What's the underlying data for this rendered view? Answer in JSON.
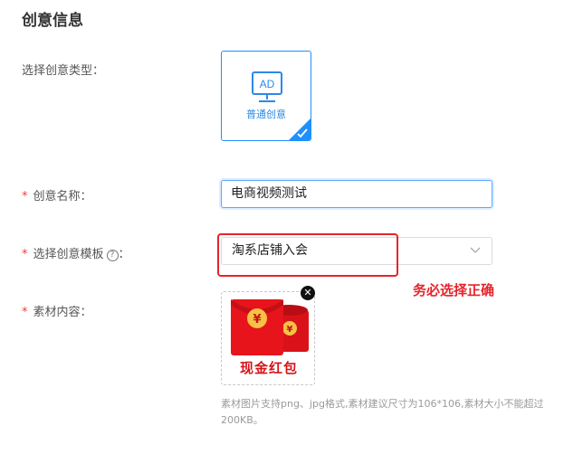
{
  "section": {
    "title": "创意信息"
  },
  "creative_type": {
    "label": "选择创意类型：",
    "card_icon_text": "AD",
    "card_label": "普通创意",
    "selected": true
  },
  "creative_name": {
    "label": "创意名称：",
    "value": "电商视频测试"
  },
  "template": {
    "label": "选择创意模板",
    "help_glyph": "?",
    "colon": "：",
    "selected_value": "淘系店铺入会"
  },
  "annotation": {
    "text": "务必选择正确",
    "color": "#e5242b"
  },
  "material": {
    "label": "素材内容：",
    "image_caption": "现金红包",
    "currency_glyph": "¥",
    "remove_glyph": "✕",
    "hint": "素材图片支持png、jpg格式,素材建议尺寸为106*106,素材大小不能超过200KB。"
  },
  "colors": {
    "accent": "#1e90ff",
    "required": "#e64340",
    "envelope_red": "#e8141b",
    "coin_gold": "#f6c244"
  }
}
